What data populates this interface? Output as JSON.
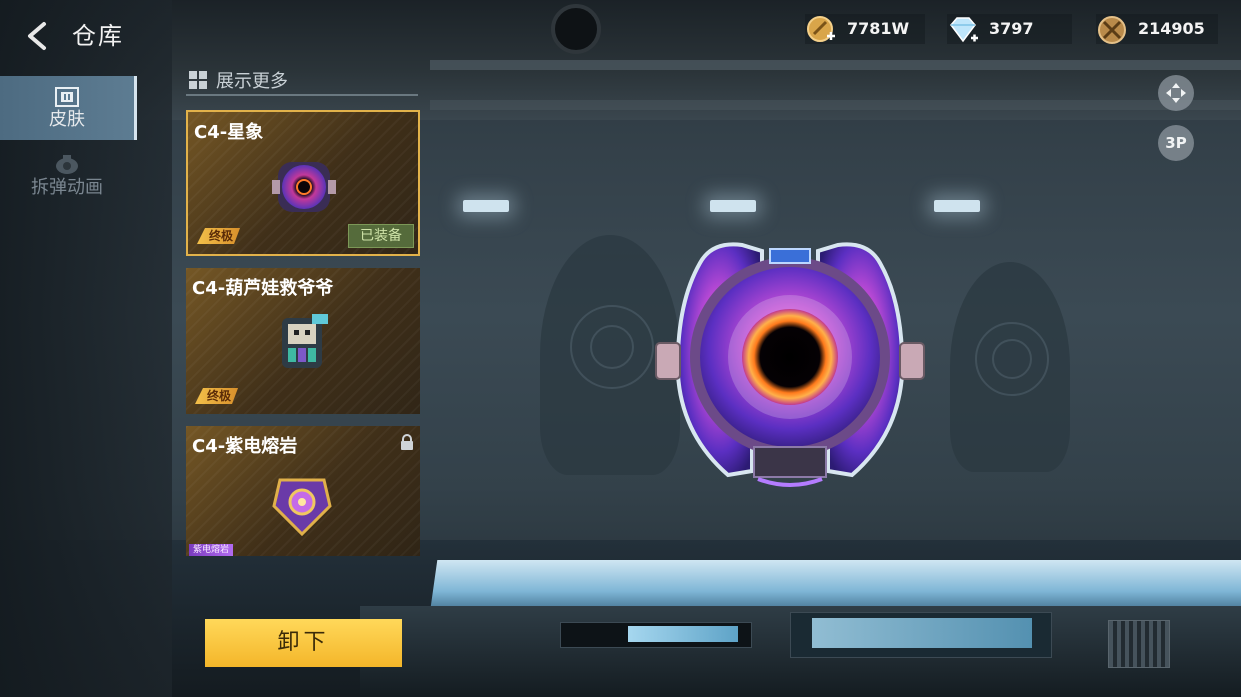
{
  "header": {
    "title": "仓库"
  },
  "sidebar": {
    "tabs": [
      {
        "label": "皮肤",
        "active": true
      },
      {
        "label": "拆弹动画",
        "active": false
      }
    ]
  },
  "list": {
    "header_label": "展示更多",
    "items": [
      {
        "name": "C4-星象",
        "grade": "终极",
        "status": "已装备",
        "selected": true
      },
      {
        "name": "C4-葫芦娃救爷爷",
        "grade": "终极"
      },
      {
        "name": "C4-紫电熔岩",
        "tag": "紫电熔岩",
        "locked": true
      }
    ]
  },
  "currencies": [
    {
      "icon": "gold-coin-icon",
      "value": "7781W"
    },
    {
      "icon": "diamond-icon",
      "value": "3797"
    },
    {
      "icon": "crossed-swords-coin-icon",
      "value": "214905"
    }
  ],
  "controls": {
    "view_mode_label": "3P"
  },
  "actions": {
    "unequip_label": "卸下"
  },
  "colors": {
    "accent_gold": "#f4b62a",
    "card_bg": "#6d5024",
    "active_tab": "#5d7c92",
    "equipped_badge": "#556b3b"
  }
}
